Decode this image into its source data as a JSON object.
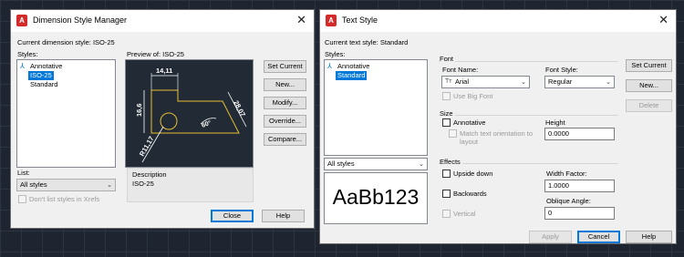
{
  "dsm": {
    "title": "Dimension Style Manager",
    "current_style_label": "Current dimension style: ISO-25",
    "styles_label": "Styles:",
    "styles": [
      "Annotative",
      "ISO-25",
      "Standard"
    ],
    "selected_style": "ISO-25",
    "preview_label": "Preview of: ISO-25",
    "preview_dims": {
      "top": "14,11",
      "left": "16,6",
      "right": "28,07",
      "angle": "60°",
      "radius": "R11,17"
    },
    "list_label": "List:",
    "list_value": "All styles",
    "dont_list_xrefs": "Don't list styles in Xrefs",
    "description_label": "Description",
    "description_value": "ISO-25",
    "buttons": {
      "set_current": "Set Current",
      "new": "New...",
      "modify": "Modify...",
      "override": "Override...",
      "compare": "Compare...",
      "close": "Close",
      "help": "Help"
    }
  },
  "ts": {
    "title": "Text Style",
    "current_style_label": "Current text style:  Standard",
    "styles_label": "Styles:",
    "styles": [
      "Annotative",
      "Standard"
    ],
    "selected_style": "Standard",
    "filter_value": "All styles",
    "preview_text": "AaBb123",
    "font": {
      "group_label": "Font",
      "font_name_label": "Font Name:",
      "font_name_value": "Arial",
      "font_style_label": "Font Style:",
      "font_style_value": "Regular",
      "use_big_font": "Use Big Font"
    },
    "size": {
      "group_label": "Size",
      "annotative": "Annotative",
      "match_orientation": "Match text orientation to layout",
      "height_label": "Height",
      "height_value": "0.0000"
    },
    "effects": {
      "group_label": "Effects",
      "upside_down": "Upside down",
      "backwards": "Backwards",
      "vertical": "Vertical",
      "width_factor_label": "Width Factor:",
      "width_factor_value": "1.0000",
      "oblique_label": "Oblique Angle:",
      "oblique_value": "0"
    },
    "buttons": {
      "set_current": "Set Current",
      "new": "New...",
      "delete": "Delete",
      "apply": "Apply",
      "cancel": "Cancel",
      "help": "Help"
    }
  }
}
